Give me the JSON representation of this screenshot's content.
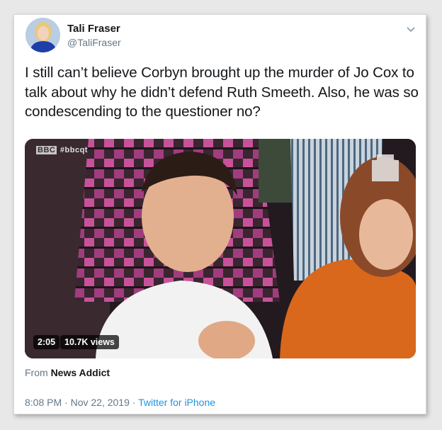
{
  "author": {
    "name": "Tali Fraser",
    "handle": "@TaliFraser"
  },
  "tweet": {
    "text": "I still can’t believe Corbyn brought up the murder of Jo Cox to talk about why he didn’t defend Ruth Smeeth. Also, he was so condescending to the questioner no?"
  },
  "media": {
    "channel": "BBC",
    "hashtag": "#bbcqt",
    "duration": "2:05",
    "views": "10.7K views",
    "source_prefix": "From",
    "source_name": "News Addict"
  },
  "meta": {
    "time": "8:08 PM",
    "date": "Nov 22, 2019",
    "separator": "·",
    "client": "Twitter for iPhone"
  },
  "icons": {
    "menu": "chevron-down-icon"
  },
  "colors": {
    "link": "#1b95e0",
    "secondary_text": "#657786",
    "primary_text": "#14171a"
  }
}
